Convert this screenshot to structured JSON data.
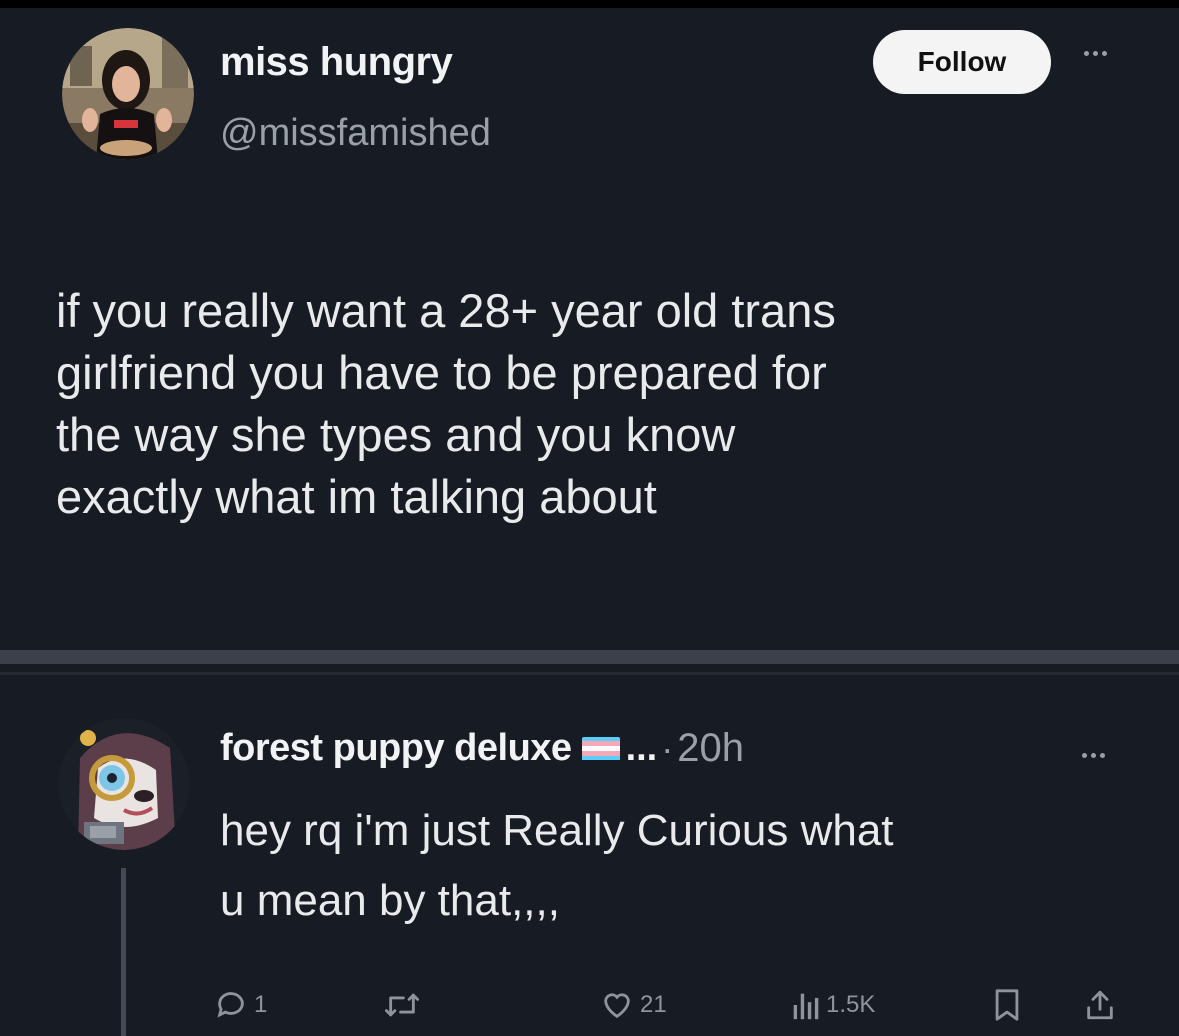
{
  "post": {
    "author_name": "miss hungry",
    "author_handle": "@missfamished",
    "follow_label": "Follow",
    "text_lines": [
      "if you really want a 28+ year old trans",
      "girlfriend you have to be prepared for",
      "the way she types and you know",
      "exactly what im talking about"
    ]
  },
  "reply": {
    "author_name": "forest puppy deluxe",
    "name_ellipsis": "...",
    "separator": "·",
    "time": "20h",
    "text_lines": [
      "hey rq i'm just Really Curious what",
      "u mean by that,,,,"
    ],
    "actions": {
      "reply_count": "1",
      "like_count": "21",
      "view_count": "1.5K"
    },
    "icons": {
      "reply": "comment-icon",
      "repost": "repost-icon",
      "like": "heart-icon",
      "views": "views-icon",
      "bookmark": "bookmark-icon",
      "share": "share-icon",
      "flag": "trans-flag-icon"
    }
  },
  "colors": {
    "background": "#161b24",
    "text_primary": "#e9eaec",
    "text_secondary": "#9aa0a8",
    "follow_button_bg": "#f4f4f4",
    "flag_blue": "#5bcefa",
    "flag_pink": "#f5a9b8",
    "flag_white": "#ffffff"
  }
}
